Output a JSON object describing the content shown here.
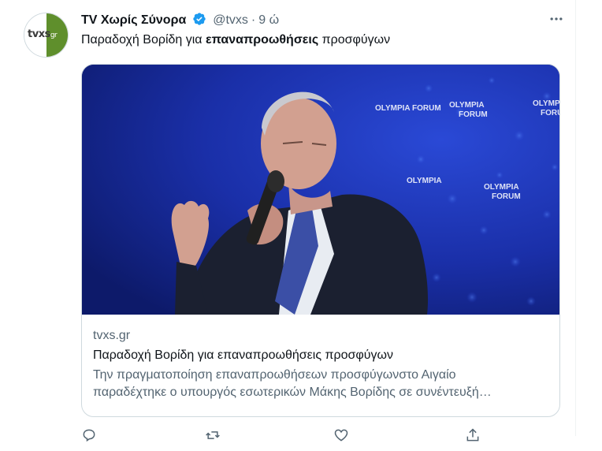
{
  "tweet": {
    "display_name": "TV Χωρίς Σύνορα",
    "handle": "@tvxs",
    "separator": "·",
    "time": "9 ώ",
    "more_label": "···",
    "text_before": "Παραδοχή Βορίδη για ",
    "text_bold": "επαναπροωθήσεις",
    "text_after": " προσφύγων",
    "verified_icon": "verified-badge-icon",
    "colors": {
      "verified": "#1d9bf0",
      "secondary_text": "#536471",
      "primary_text": "#0f1419",
      "border": "#cfd9de"
    }
  },
  "avatar": {
    "logo_text": "tvxs",
    "logo_suffix": "gr"
  },
  "card": {
    "domain": "tvxs.gr",
    "title": "Παραδοχή Βορίδη για επαναπροωθήσεις προσφύγων",
    "description_line1": "Την πραγματοποίηση επαναπροωθήσεων προσφύγωνστο Αιγαίο",
    "description_line2": "παραδέχτηκε ο υπουργός εσωτερικών Μάκης Βορίδης σε συνέντευξή…",
    "image_backdrop_text": "OLYMPIA FORUM"
  },
  "actions": [
    {
      "name": "reply-icon"
    },
    {
      "name": "retweet-icon"
    },
    {
      "name": "like-icon"
    },
    {
      "name": "share-icon"
    }
  ]
}
